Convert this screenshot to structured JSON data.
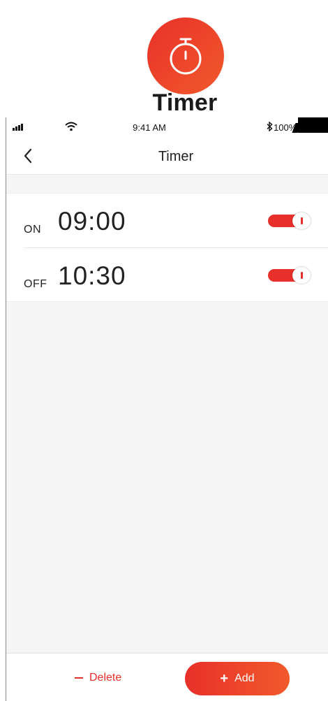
{
  "header": {
    "app_icon": "stopwatch-icon",
    "title": "Timer"
  },
  "status_bar": {
    "time": "9:41 AM",
    "battery": "100%",
    "icons": [
      "signal-icon",
      "wifi-icon",
      "bluetooth-icon",
      "battery-icon"
    ]
  },
  "nav": {
    "back_icon": "chevron-left-icon",
    "title": "Timer"
  },
  "timers": [
    {
      "label": "ON",
      "time": "09:00",
      "enabled": true
    },
    {
      "label": "OFF",
      "time": "10:30",
      "enabled": true
    }
  ],
  "bottom": {
    "delete_label": "Delete",
    "add_label": "Add"
  },
  "colors": {
    "accent": "#e8302a",
    "accent_end": "#f15a2b",
    "background": "#f5f5f5"
  }
}
